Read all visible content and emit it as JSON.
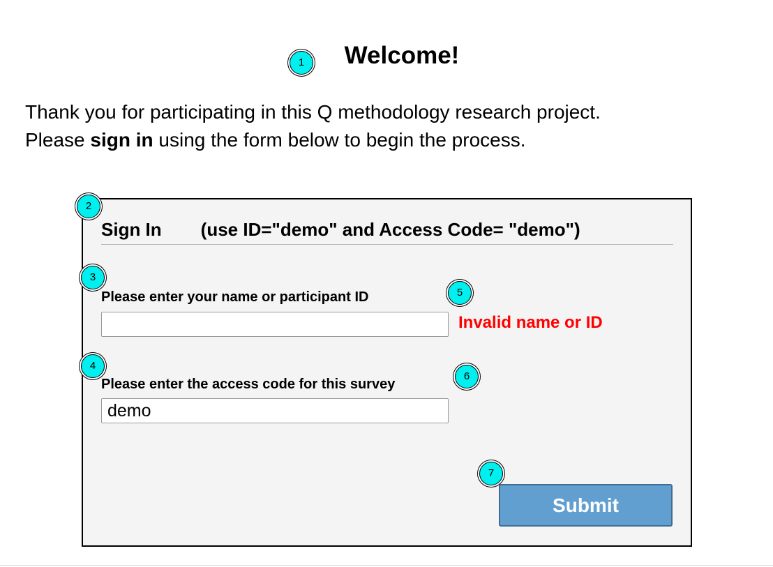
{
  "page": {
    "title": "Welcome!",
    "intro_line1": "Thank you for participating in this Q methodology research project.",
    "intro_line2_before": "Please ",
    "intro_line2_bold": "sign in",
    "intro_line2_after": " using the form below to begin the process."
  },
  "signin": {
    "title": "Sign In",
    "hint": "(use ID=\"demo\" and Access Code= \"demo\")",
    "name_label": "Please enter your name or participant ID",
    "name_value": "",
    "name_error": "Invalid name or ID",
    "code_label": "Please enter the access code for this survey",
    "code_value": "demo",
    "submit_label": "Submit"
  },
  "markers": [
    "1",
    "2",
    "3",
    "4",
    "5",
    "6",
    "7"
  ],
  "colors": {
    "marker_fill": "#00f0f0",
    "error": "#ff0000",
    "submit_bg": "#629fd1",
    "panel_bg": "#f4f4f4"
  }
}
